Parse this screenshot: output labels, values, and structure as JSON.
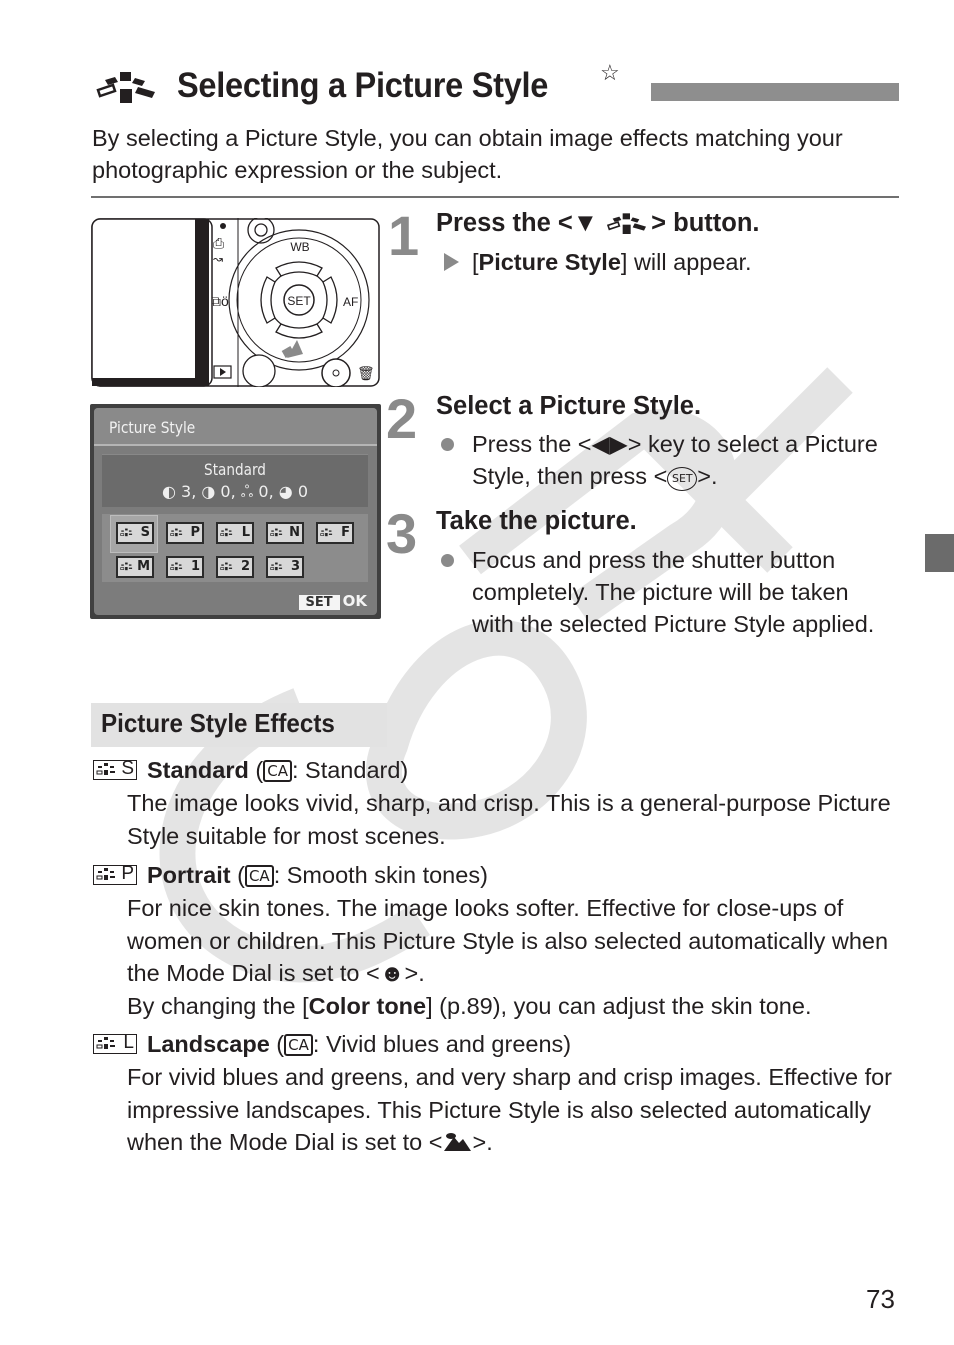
{
  "page": {
    "title": "Selecting a Picture Style",
    "title_icon": "picture-style-icon",
    "title_mark": "☆",
    "intro": "By selecting a Picture Style, you can obtain image effects matching your photographic expression or the subject.",
    "page_number": "73"
  },
  "camera_illustration": {
    "labels": {
      "wb": "WB",
      "set": "SET",
      "af": "AF"
    },
    "icons": [
      "drive-mode-icon",
      "self-timer-icon",
      "playback-icon",
      "erase-icon",
      "print-icon",
      "arrow-pointer-icon"
    ]
  },
  "menu_screen": {
    "title": "Picture Style",
    "selected_style": "Standard",
    "params": "◐ 3, ◑ 0, ஃ 0, ◕ 0",
    "param_values": {
      "sharpness": 3,
      "contrast": 0,
      "saturation": 0,
      "color_tone": 0
    },
    "styles": [
      {
        "code": "S",
        "selected": true
      },
      {
        "code": "P",
        "selected": false
      },
      {
        "code": "L",
        "selected": false
      },
      {
        "code": "N",
        "selected": false
      },
      {
        "code": "F",
        "selected": false
      },
      {
        "code": "M",
        "selected": false
      },
      {
        "code": "1",
        "selected": false
      },
      {
        "code": "2",
        "selected": false
      },
      {
        "code": "3",
        "selected": false
      }
    ],
    "set_label": "SET",
    "ok_label": "OK"
  },
  "steps": [
    {
      "number": "1",
      "heading_pre": "Press the <",
      "heading_icon": "▼",
      "heading_post": "> button.",
      "result_bold": "Picture Style",
      "result_text": "] will appear.",
      "result_open": "["
    },
    {
      "number": "2",
      "heading": "Select a Picture Style.",
      "body_pre": "Press the <",
      "body_keys": "◀▶",
      "body_mid": "> key to select a Picture Style, then press <",
      "body_set": "SET",
      "body_post": ">."
    },
    {
      "number": "3",
      "heading": "Take the picture.",
      "body": "Focus and press the shutter button completely. The picture will be taken with the selected Picture Style applied."
    }
  ],
  "effects": {
    "header": "Picture Style Effects",
    "items": [
      {
        "code": "S",
        "name": "Standard",
        "ca_label": "CA",
        "ca_desc": ": Standard)",
        "desc": "The image looks vivid, sharp, and crisp. This is a general-purpose Picture Style suitable for most scenes."
      },
      {
        "code": "P",
        "name": "Portrait",
        "ca_label": "CA",
        "ca_desc": ": Smooth skin tones)",
        "desc": "For nice skin tones. The image looks softer. Effective for close-ups of women or children. This Picture Style is also selected automatically when the Mode Dial is set to <",
        "desc_icon": "portrait-mode-icon",
        "desc_end": ">.",
        "extra_pre": "By changing the [",
        "extra_bold": "Color tone",
        "extra_post": "] (p.89), you can adjust the skin tone."
      },
      {
        "code": "L",
        "name": "Landscape",
        "ca_label": "CA",
        "ca_desc": ": Vivid blues and greens)",
        "desc": "For vivid blues and greens, and very sharp and crisp images. Effective for impressive landscapes. This Picture Style is also selected automatically when the Mode Dial is set to <",
        "desc_icon": "landscape-mode-icon",
        "desc_end": ">."
      }
    ]
  },
  "watermark": {
    "text": "COPY",
    "color": "#dcdcdc"
  },
  "colors": {
    "accent_gray": "#8a8a8a",
    "title_bar": "#8e8e8e",
    "side_tab": "#6b6b6b",
    "text": "#231f20"
  }
}
